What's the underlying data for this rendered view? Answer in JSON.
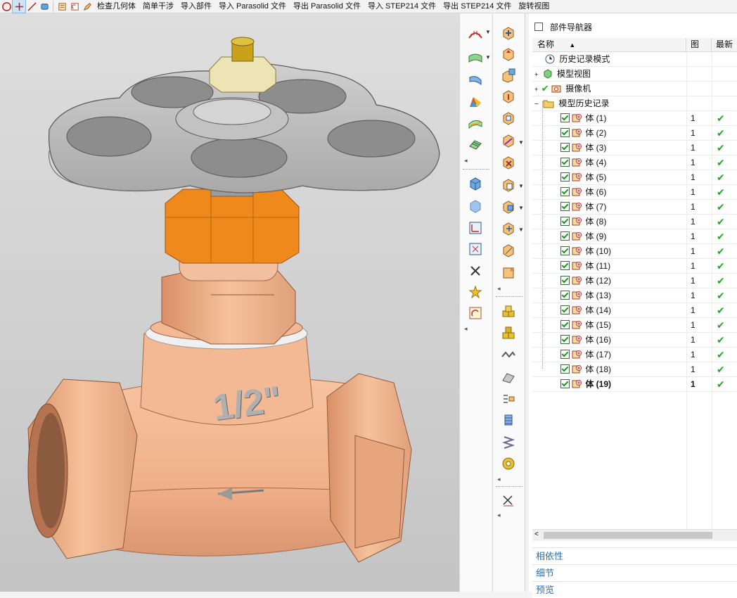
{
  "toolbar": {
    "icons": [
      "circle-icon",
      "crosshair-plus-icon",
      "line-tool-icon",
      "eraser-icon",
      "layer-icon",
      "history-icon",
      "edit-icon"
    ],
    "labels": [
      "检查几何体",
      "简单干涉",
      "导入部件",
      "导入 Parasolid 文件",
      "导出 Parasolid 文件",
      "导入 STEP214 文件",
      "导出 STEP214 文件",
      "旋转视图"
    ]
  },
  "model": {
    "label_text": "1/2\"",
    "colors": {
      "copper": "#f2b58f",
      "copper_dark": "#c8845d",
      "orange": "#f08a1a",
      "handwheel": "#b4b4b4",
      "nut": "#ece4b4"
    }
  },
  "navigator": {
    "title": "部件导航器",
    "columns": {
      "name": "名称",
      "pic": "图",
      "latest": "最新"
    },
    "tree": [
      {
        "label": "历史记录模式",
        "icon": "clock-icon",
        "level": 0
      },
      {
        "label": "模型视图",
        "icon": "cube-views-icon",
        "level": 0
      },
      {
        "label": "摄像机",
        "icon": "camera-icon",
        "level": 1
      },
      {
        "label": "模型历史记录",
        "icon": "folder-icon",
        "level": 0
      }
    ],
    "bodies": [
      {
        "label": "体 (1)",
        "pic": "1"
      },
      {
        "label": "体 (2)",
        "pic": "1"
      },
      {
        "label": "体 (3)",
        "pic": "1"
      },
      {
        "label": "体 (4)",
        "pic": "1"
      },
      {
        "label": "体 (5)",
        "pic": "1"
      },
      {
        "label": "体 (6)",
        "pic": "1"
      },
      {
        "label": "体 (7)",
        "pic": "1"
      },
      {
        "label": "体 (8)",
        "pic": "1"
      },
      {
        "label": "体 (9)",
        "pic": "1"
      },
      {
        "label": "体 (10)",
        "pic": "1"
      },
      {
        "label": "体 (11)",
        "pic": "1"
      },
      {
        "label": "体 (12)",
        "pic": "1"
      },
      {
        "label": "体 (13)",
        "pic": "1"
      },
      {
        "label": "体 (14)",
        "pic": "1"
      },
      {
        "label": "体 (15)",
        "pic": "1"
      },
      {
        "label": "体 (16)",
        "pic": "1"
      },
      {
        "label": "体 (17)",
        "pic": "1"
      },
      {
        "label": "体 (18)",
        "pic": "1"
      },
      {
        "label": "体 (19)",
        "pic": "1"
      }
    ],
    "sections": [
      "相依性",
      "细节",
      "预览"
    ]
  }
}
